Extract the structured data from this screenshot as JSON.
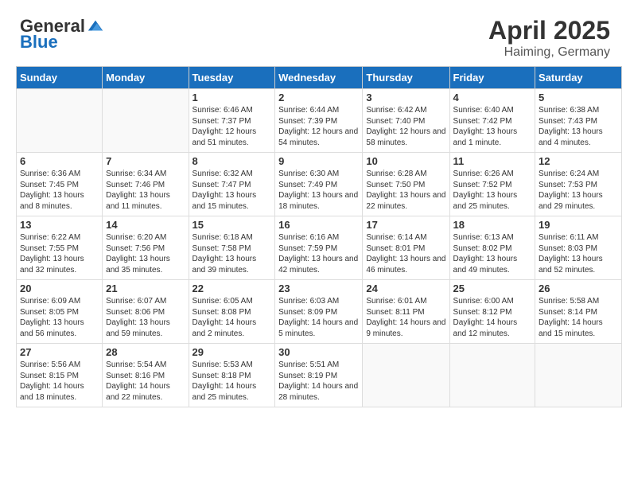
{
  "header": {
    "logo_general": "General",
    "logo_blue": "Blue",
    "month_year": "April 2025",
    "location": "Haiming, Germany"
  },
  "weekdays": [
    "Sunday",
    "Monday",
    "Tuesday",
    "Wednesday",
    "Thursday",
    "Friday",
    "Saturday"
  ],
  "weeks": [
    [
      {
        "day": "",
        "info": ""
      },
      {
        "day": "",
        "info": ""
      },
      {
        "day": "1",
        "info": "Sunrise: 6:46 AM\nSunset: 7:37 PM\nDaylight: 12 hours and 51 minutes."
      },
      {
        "day": "2",
        "info": "Sunrise: 6:44 AM\nSunset: 7:39 PM\nDaylight: 12 hours and 54 minutes."
      },
      {
        "day": "3",
        "info": "Sunrise: 6:42 AM\nSunset: 7:40 PM\nDaylight: 12 hours and 58 minutes."
      },
      {
        "day": "4",
        "info": "Sunrise: 6:40 AM\nSunset: 7:42 PM\nDaylight: 13 hours and 1 minute."
      },
      {
        "day": "5",
        "info": "Sunrise: 6:38 AM\nSunset: 7:43 PM\nDaylight: 13 hours and 4 minutes."
      }
    ],
    [
      {
        "day": "6",
        "info": "Sunrise: 6:36 AM\nSunset: 7:45 PM\nDaylight: 13 hours and 8 minutes."
      },
      {
        "day": "7",
        "info": "Sunrise: 6:34 AM\nSunset: 7:46 PM\nDaylight: 13 hours and 11 minutes."
      },
      {
        "day": "8",
        "info": "Sunrise: 6:32 AM\nSunset: 7:47 PM\nDaylight: 13 hours and 15 minutes."
      },
      {
        "day": "9",
        "info": "Sunrise: 6:30 AM\nSunset: 7:49 PM\nDaylight: 13 hours and 18 minutes."
      },
      {
        "day": "10",
        "info": "Sunrise: 6:28 AM\nSunset: 7:50 PM\nDaylight: 13 hours and 22 minutes."
      },
      {
        "day": "11",
        "info": "Sunrise: 6:26 AM\nSunset: 7:52 PM\nDaylight: 13 hours and 25 minutes."
      },
      {
        "day": "12",
        "info": "Sunrise: 6:24 AM\nSunset: 7:53 PM\nDaylight: 13 hours and 29 minutes."
      }
    ],
    [
      {
        "day": "13",
        "info": "Sunrise: 6:22 AM\nSunset: 7:55 PM\nDaylight: 13 hours and 32 minutes."
      },
      {
        "day": "14",
        "info": "Sunrise: 6:20 AM\nSunset: 7:56 PM\nDaylight: 13 hours and 35 minutes."
      },
      {
        "day": "15",
        "info": "Sunrise: 6:18 AM\nSunset: 7:58 PM\nDaylight: 13 hours and 39 minutes."
      },
      {
        "day": "16",
        "info": "Sunrise: 6:16 AM\nSunset: 7:59 PM\nDaylight: 13 hours and 42 minutes."
      },
      {
        "day": "17",
        "info": "Sunrise: 6:14 AM\nSunset: 8:01 PM\nDaylight: 13 hours and 46 minutes."
      },
      {
        "day": "18",
        "info": "Sunrise: 6:13 AM\nSunset: 8:02 PM\nDaylight: 13 hours and 49 minutes."
      },
      {
        "day": "19",
        "info": "Sunrise: 6:11 AM\nSunset: 8:03 PM\nDaylight: 13 hours and 52 minutes."
      }
    ],
    [
      {
        "day": "20",
        "info": "Sunrise: 6:09 AM\nSunset: 8:05 PM\nDaylight: 13 hours and 56 minutes."
      },
      {
        "day": "21",
        "info": "Sunrise: 6:07 AM\nSunset: 8:06 PM\nDaylight: 13 hours and 59 minutes."
      },
      {
        "day": "22",
        "info": "Sunrise: 6:05 AM\nSunset: 8:08 PM\nDaylight: 14 hours and 2 minutes."
      },
      {
        "day": "23",
        "info": "Sunrise: 6:03 AM\nSunset: 8:09 PM\nDaylight: 14 hours and 5 minutes."
      },
      {
        "day": "24",
        "info": "Sunrise: 6:01 AM\nSunset: 8:11 PM\nDaylight: 14 hours and 9 minutes."
      },
      {
        "day": "25",
        "info": "Sunrise: 6:00 AM\nSunset: 8:12 PM\nDaylight: 14 hours and 12 minutes."
      },
      {
        "day": "26",
        "info": "Sunrise: 5:58 AM\nSunset: 8:14 PM\nDaylight: 14 hours and 15 minutes."
      }
    ],
    [
      {
        "day": "27",
        "info": "Sunrise: 5:56 AM\nSunset: 8:15 PM\nDaylight: 14 hours and 18 minutes."
      },
      {
        "day": "28",
        "info": "Sunrise: 5:54 AM\nSunset: 8:16 PM\nDaylight: 14 hours and 22 minutes."
      },
      {
        "day": "29",
        "info": "Sunrise: 5:53 AM\nSunset: 8:18 PM\nDaylight: 14 hours and 25 minutes."
      },
      {
        "day": "30",
        "info": "Sunrise: 5:51 AM\nSunset: 8:19 PM\nDaylight: 14 hours and 28 minutes."
      },
      {
        "day": "",
        "info": ""
      },
      {
        "day": "",
        "info": ""
      },
      {
        "day": "",
        "info": ""
      }
    ]
  ]
}
